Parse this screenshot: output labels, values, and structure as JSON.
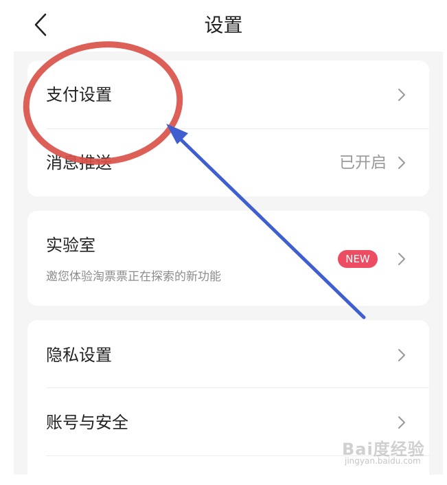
{
  "header": {
    "title": "设置",
    "back_icon": "chevron-left-icon"
  },
  "groups": [
    {
      "rows": [
        {
          "label": "支付设置",
          "value": "",
          "icon": "chevron-right-icon"
        },
        {
          "label": "消息推送",
          "value": "已开启",
          "icon": "chevron-right-icon"
        }
      ]
    },
    {
      "rows": [
        {
          "label": "实验室",
          "subtitle": "邀您体验淘票票正在探索的新功能",
          "badge": "NEW",
          "icon": "chevron-right-icon"
        }
      ]
    },
    {
      "rows": [
        {
          "label": "隐私设置",
          "icon": "chevron-right-icon"
        },
        {
          "label": "账号与安全",
          "icon": "chevron-right-icon"
        }
      ]
    }
  ],
  "annotations": {
    "circle_color": "#d9534a",
    "arrow_color": "#3f5fd0"
  },
  "watermark": {
    "text": "Bai度经验",
    "url": "jingyan.baidu.com"
  },
  "colors": {
    "background": "#f5f5f5",
    "card": "#ffffff",
    "badge": "#ec4d63",
    "secondary_text": "#999999"
  }
}
